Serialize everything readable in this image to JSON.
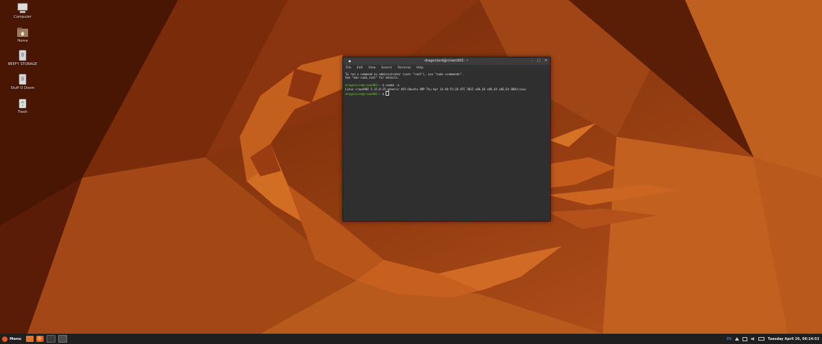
{
  "desktop": {
    "icons": [
      {
        "label": "Computer",
        "icon": "computer-icon"
      },
      {
        "label": "Home",
        "icon": "home-folder-icon"
      },
      {
        "label": "BEEFY STORAGE",
        "icon": "drive-icon"
      },
      {
        "label": "Stuff O Doom",
        "icon": "drive-icon"
      },
      {
        "label": "Trash",
        "icon": "trash-icon"
      }
    ]
  },
  "terminal": {
    "title": "dragonlord@crown902: ~",
    "window_controls": [
      "–",
      "□",
      "✕"
    ],
    "menu": [
      "File",
      "Edit",
      "View",
      "Search",
      "Terminal",
      "Help"
    ],
    "lines": [
      "To run a command as administrator (user \"root\"), use \"sudo <command>\".",
      "See \"man sudo_root\" for details.",
      "",
      "Linux crown902 5.15.0-25-generic #25-Ubuntu SMP Thu Apr 14 04:53:28 UTC 2022 x86_64 x86_64 x86_64 GNU/Linux"
    ],
    "prompt": "dragonlord@crown902:~",
    "command": "$ uname -a",
    "prompt_end": "$"
  },
  "taskbar": {
    "menu_label": "Menu",
    "launchers": [
      "files-icon",
      "firefox-icon",
      "terminal-icon",
      "window-icon"
    ],
    "tray": {
      "lang": "EN",
      "clock": "Tuesday April 26, 06:14:53"
    }
  },
  "colors": {
    "wallpaper_base": "#5a1d06",
    "accent": "#e95420",
    "prompt_green": "#6fd03a"
  }
}
